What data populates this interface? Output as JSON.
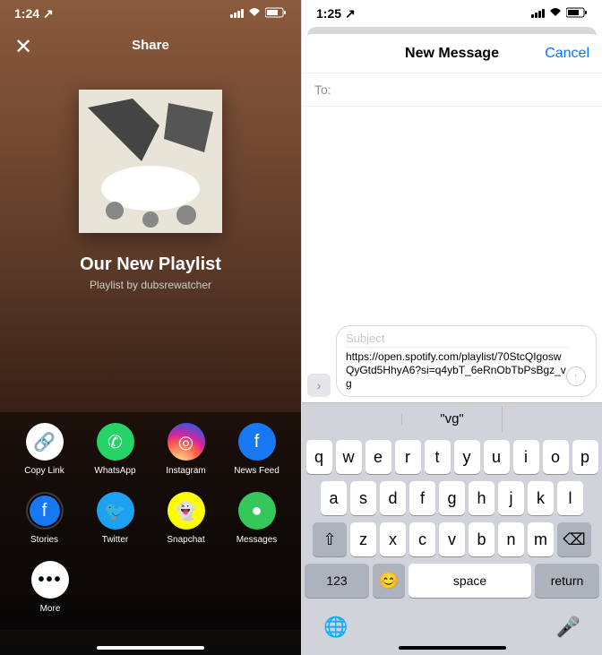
{
  "left": {
    "status": {
      "time": "1:24",
      "location_arrow": "↗"
    },
    "header": {
      "title": "Share",
      "close": "✕"
    },
    "playlist": {
      "title": "Our New Playlist",
      "subtitle": "Playlist by dubsrewatcher"
    },
    "share_options": {
      "row1": [
        {
          "label": "Copy Link",
          "glyph": "🔗"
        },
        {
          "label": "WhatsApp",
          "glyph": "✆"
        },
        {
          "label": "Instagram",
          "glyph": "◎"
        },
        {
          "label": "News Feed",
          "glyph": "f"
        }
      ],
      "row2": [
        {
          "label": "Stories",
          "glyph": "f"
        },
        {
          "label": "Twitter",
          "glyph": "🐦"
        },
        {
          "label": "Snapchat",
          "glyph": "👻"
        },
        {
          "label": "Messages",
          "glyph": "●"
        }
      ],
      "row3": [
        {
          "label": "More",
          "glyph": "•••"
        }
      ]
    }
  },
  "right": {
    "status": {
      "time": "1:25",
      "location_arrow": "↗"
    },
    "header": {
      "title": "New Message",
      "cancel": "Cancel"
    },
    "to_label": "To:",
    "compose": {
      "subject_placeholder": "Subject",
      "body": "https://open.spotify.com/playlist/70StcQIgoswQyGtd5HhyA6?si=q4ybT_6eRnObTbPsBgz_vg"
    },
    "predictive": {
      "left": "",
      "center": "\"vg\"",
      "right": ""
    },
    "keyboard": {
      "row1": [
        "q",
        "w",
        "e",
        "r",
        "t",
        "y",
        "u",
        "i",
        "o",
        "p"
      ],
      "row2": [
        "a",
        "s",
        "d",
        "f",
        "g",
        "h",
        "j",
        "k",
        "l"
      ],
      "row3": [
        "z",
        "x",
        "c",
        "v",
        "b",
        "n",
        "m"
      ],
      "shift": "⇧",
      "backspace": "⌫",
      "k123": "123",
      "emoji": "😊",
      "space": "space",
      "return": "return",
      "globe": "🌐",
      "mic": "🎤"
    }
  }
}
